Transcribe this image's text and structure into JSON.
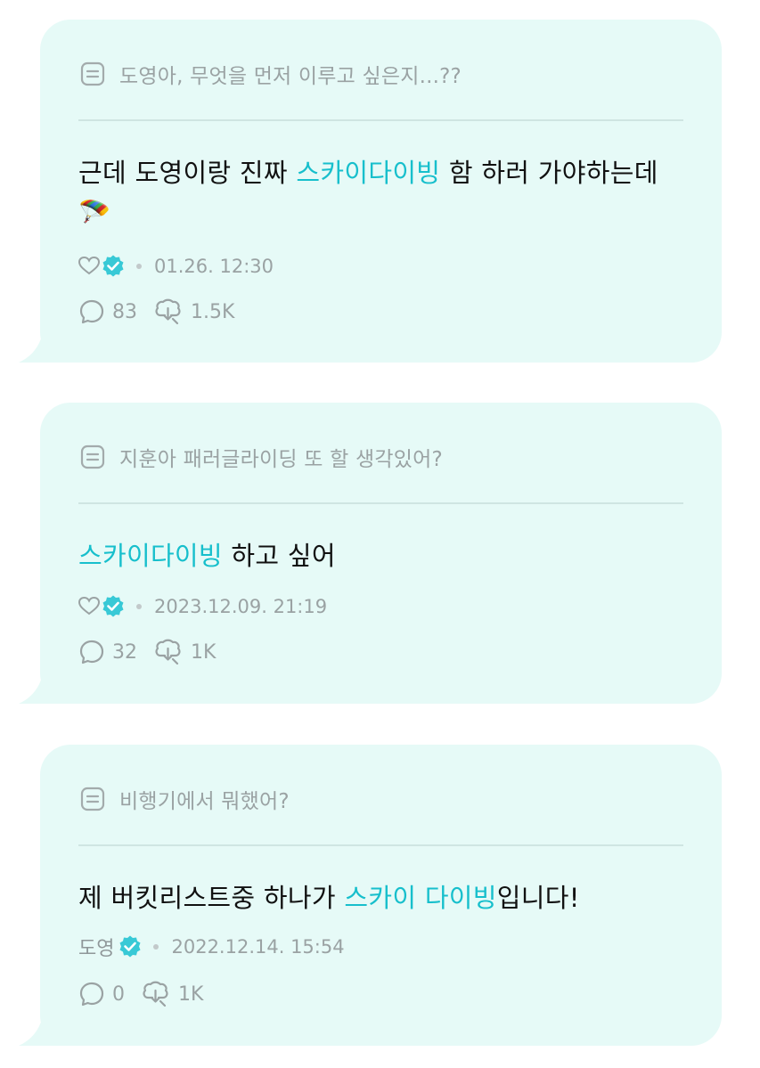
{
  "cards": [
    {
      "question": "도영아, 무엇을 먼저 이루고 싶은지...??",
      "answer_before": "근데 도영이랑 진짜 ",
      "answer_highlight": "스카이다이빙",
      "answer_after": " 함 하러 가야하는데",
      "answer_emoji": "🪂",
      "author_name": "",
      "author_icon": "heart-icon",
      "timestamp": "01.26. 12:30",
      "comments": "83",
      "reposts": "1.5K"
    },
    {
      "question": "지훈아 패러글라이딩 또 할 생각있어?",
      "answer_before": "",
      "answer_highlight": "스카이다이빙",
      "answer_after": " 하고 싶어",
      "author_name": "",
      "author_icon": "heart-icon",
      "timestamp": "2023.12.09. 21:19",
      "comments": "32",
      "reposts": "1K"
    },
    {
      "question": "비행기에서 뭐했어?",
      "answer_before": "제 버킷리스트중 하나가 ",
      "answer_highlight": "스카이 다이빙",
      "answer_after": "입니다!",
      "author_name": "도영",
      "timestamp": "2022.12.14. 15:54",
      "comments": "0",
      "reposts": "1K"
    }
  ],
  "colors": {
    "card_background": "#e6faf7",
    "highlight": "#17bfcc",
    "verified_badge": "#38c9d6",
    "muted_text": "#9aa2a3"
  }
}
